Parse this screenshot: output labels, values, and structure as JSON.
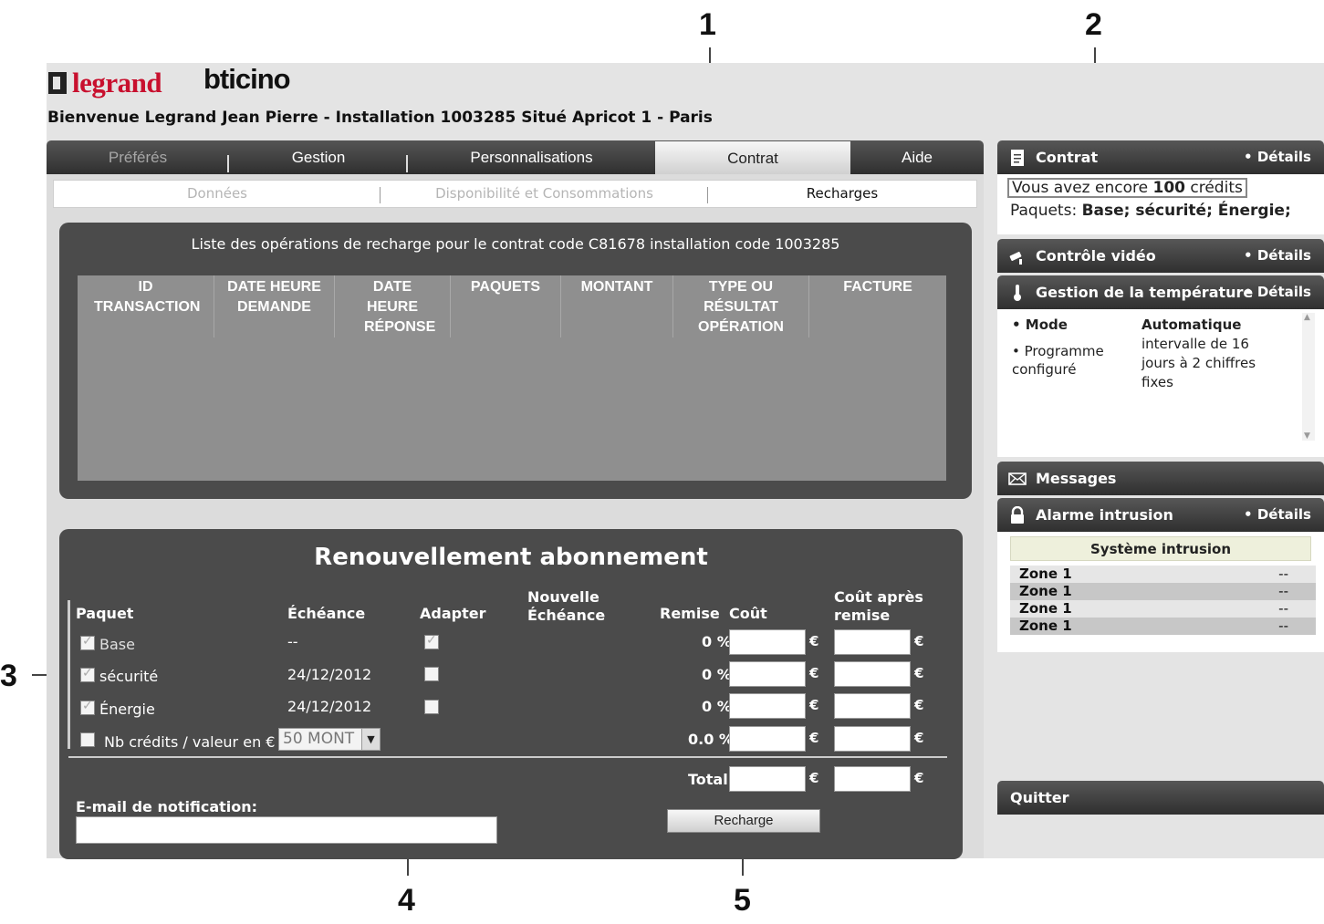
{
  "callouts": [
    "1",
    "2",
    "3",
    "4",
    "5"
  ],
  "logos": {
    "legrand": "legrand",
    "bticino": "bticino"
  },
  "welcome": "Bienvenue Legrand Jean Pierre - Installation 1003285 Situé Apricot 1 - Paris",
  "main_tabs": [
    "Préférés",
    "Gestion",
    "Personnalisations",
    "Contrat",
    "Aide"
  ],
  "sub_tabs": [
    "Données",
    "Disponibilité et Consommations",
    "Recharges"
  ],
  "operations": {
    "title": "Liste des opérations de recharge pour le contrat code C81678 installation code 1003285",
    "columns": [
      "ID TRANSACTION",
      "DATE HEURE DEMANDE",
      "DATE HEURE RÉPONSE",
      "PAQUETS",
      "MONTANT",
      "TYPE OU RÉSULTAT OPÉRATION",
      "FACTURE"
    ]
  },
  "renewal": {
    "title": "Renouvellement abonnement",
    "headers": {
      "paquet": "Paquet",
      "echeance": "Échéance",
      "adapter": "Adapter",
      "nouvelle_line1": "Nouvelle",
      "nouvelle_line2": "Échéance",
      "remise": "Remise",
      "cout": "Coût",
      "cout_apres_line1": "Coût après",
      "cout_apres_line2": "remise"
    },
    "rows": [
      {
        "label": "Base",
        "echeance": "--",
        "remise": "0 %"
      },
      {
        "label": "sécurité",
        "echeance": "24/12/2012",
        "remise": "0 %"
      },
      {
        "label": "Énergie",
        "echeance": "24/12/2012",
        "remise": "0 %"
      }
    ],
    "credits": {
      "label": "Nb crédits / valeur en €",
      "select_value": "50 MONT",
      "remise": "0.0 %"
    },
    "euro": "€",
    "total_label": "Total",
    "email_label": "E-mail de notification:",
    "recharge_button": "Recharge"
  },
  "sidebar": {
    "contrat": {
      "title": "Contrat",
      "details": "• Détails",
      "credits_prefix": "Vous avez encore ",
      "credits_value": "100",
      "credits_suffix": " crédits",
      "paquets_label": "Paquets: ",
      "paquets_value": "Base; sécurité; Énergie;"
    },
    "video": {
      "title": "Contrôle vidéo",
      "details": "• Détails"
    },
    "temperature": {
      "title": "Gestion de la température",
      "details": "• Détails",
      "mode_label": "• Mode",
      "mode_value": "Automatique",
      "programme_label": "• Programme configuré",
      "programme_value": "intervalle de 16 jours à 2 chiffres fixes"
    },
    "messages": {
      "title": "Messages"
    },
    "alarme": {
      "title": "Alarme intrusion",
      "details": "• Détails",
      "system": "Système intrusion",
      "zones": [
        {
          "name": "Zone 1",
          "value": "--"
        },
        {
          "name": "Zone 1",
          "value": "--"
        },
        {
          "name": "Zone 1",
          "value": "--"
        },
        {
          "name": "Zone 1",
          "value": "--"
        }
      ]
    },
    "quitter": "Quitter"
  }
}
